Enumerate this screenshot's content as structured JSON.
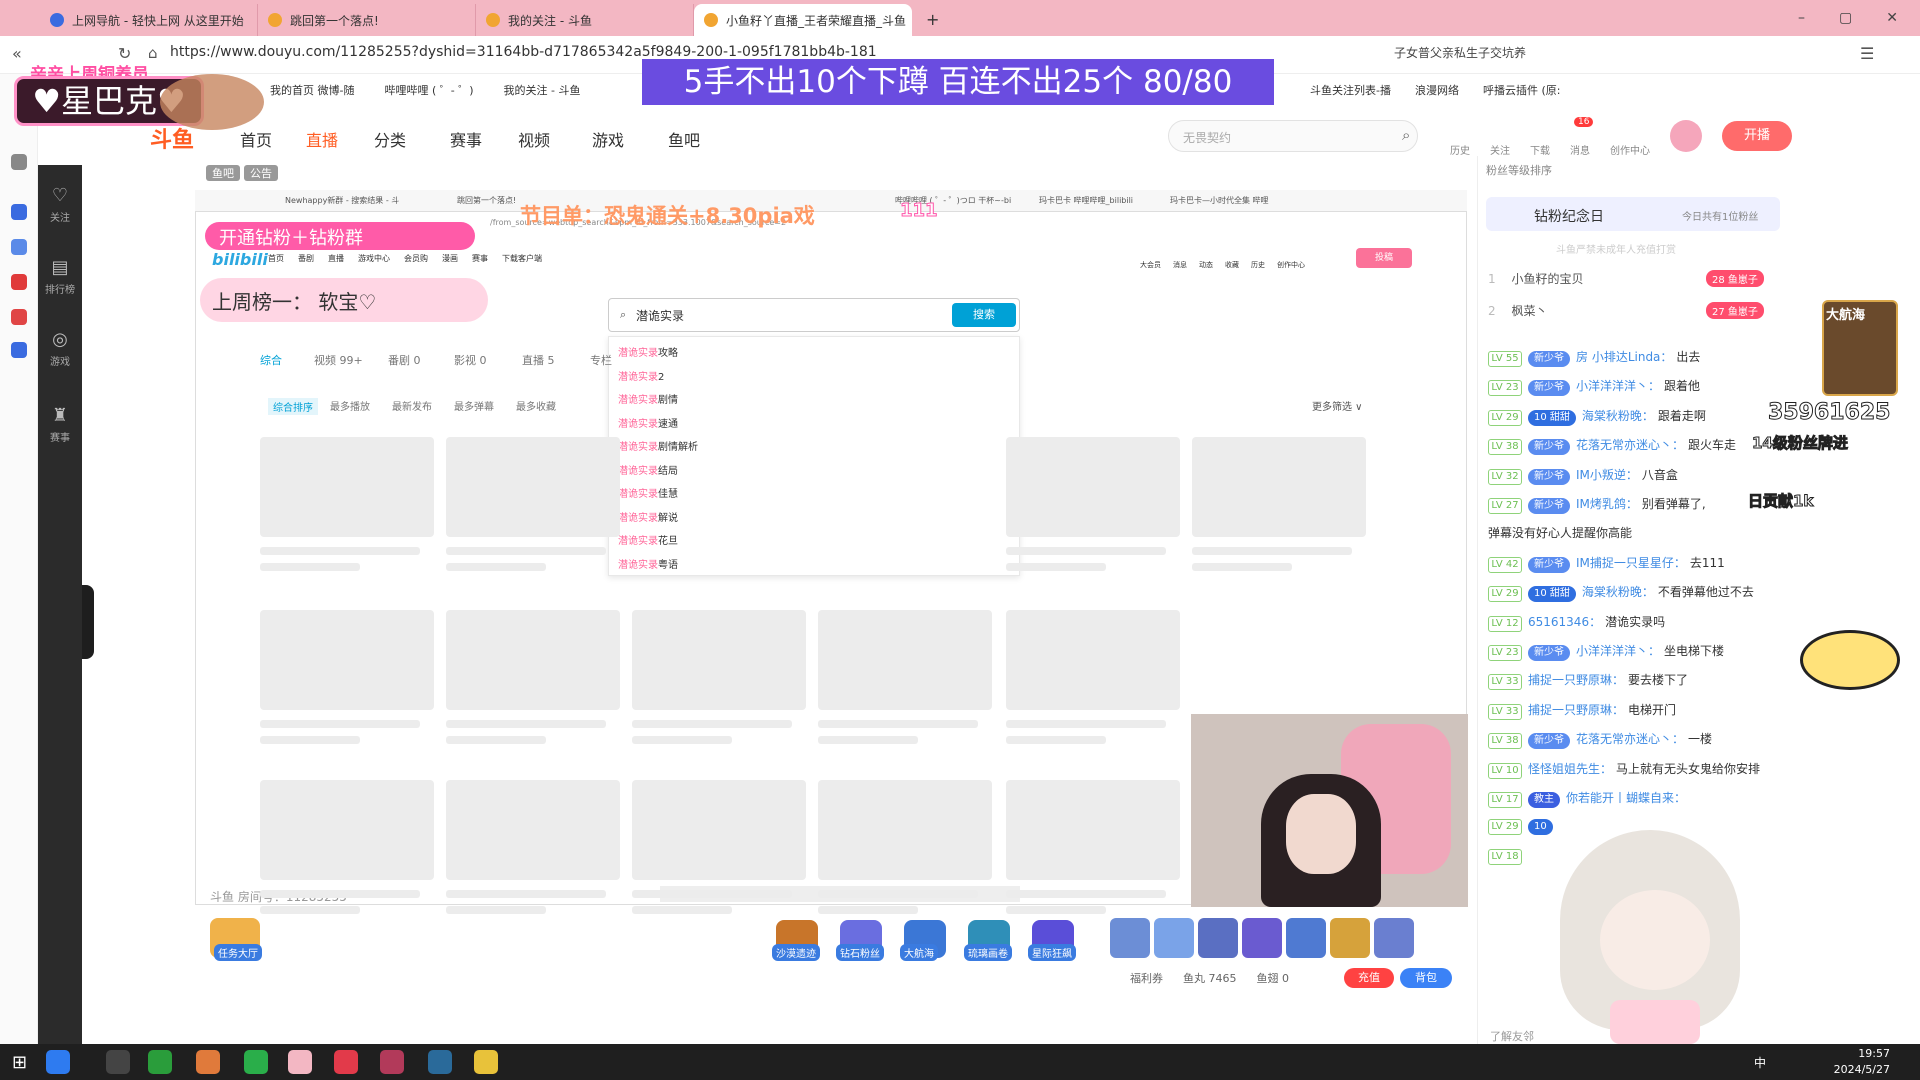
{
  "browser": {
    "tabs": [
      {
        "title": "上网导航 - 轻快上网 从这里开始"
      },
      {
        "title": "跳回第一个落点!"
      },
      {
        "title": "我的关注 - 斗鱼"
      },
      {
        "title": "小鱼籽丫直播_王者荣耀直播_斗鱼"
      }
    ],
    "url": "https://www.douyu.com/11285255?dyshid=31164bb-d717865342a5f9849-200-1-095f1781bb4b-181",
    "bookmarks": [
      "我的首页 微博-随",
      "哔哩哔哩 ( ゜- ゜)",
      "我的关注 - 斗鱼",
      "斗鱼关注列表-播",
      "浪漫网络",
      "呼播云插件 (原:",
      "子女普父亲私生子交坑养"
    ],
    "window_controls": [
      "–",
      "▢",
      "✕"
    ]
  },
  "douyu_header": {
    "logo": "斗鱼",
    "nav": [
      "首页",
      "直播",
      "分类",
      "赛事",
      "视频",
      "游戏",
      "鱼吧"
    ],
    "search_placeholder": "无畏契约",
    "icons": [
      "历史",
      "关注",
      "下载",
      "消息",
      "创作中心"
    ],
    "message_count": "16",
    "kaibo": "开播"
  },
  "douyu_sidebar": [
    "关注",
    "排行榜",
    "游戏",
    "赛事"
  ],
  "stream_overlay": {
    "title": "5手不出10个下蹲  百连不出25个  80/80",
    "xingbake": "♥星巴克♥",
    "xingbake_top": "亲亲上周铜养员",
    "program": "节目单：恐鬼通关+8.30pia戏",
    "program_num": "111",
    "kaitong": "开通钻粉＋钻粉群",
    "last_week": "上周榜一：  软宝♡",
    "fans_level_text": "粉丝等级排序",
    "dim_room": "斗鱼 房间号：11285255",
    "top_tabs": [
      "鱼吧",
      "公告"
    ]
  },
  "inner_browser": {
    "tabs": [
      "Newhappy新群 - 搜索结果 - 斗",
      "跳回第一个落点!",
      "哔哩哔哩 ( ゜- ゜)つロ 干杯~-bi",
      "玛卡巴卡 哔哩哔哩_bilibili",
      "玛卡巴卡—小时代全集 哔哩"
    ],
    "url": "/from_source=webtop_search&spm_id_from=333.1007&search_source=2",
    "bili_nav": [
      "首页",
      "番剧",
      "直播",
      "游戏中心",
      "会员购",
      "漫画",
      "赛事",
      "下载客户端"
    ],
    "search_value": "潜诡实录",
    "search_button": "搜索",
    "suggestions": [
      {
        "hl": "潜诡实录",
        "rest": "攻略"
      },
      {
        "hl": "潜诡实录",
        "rest": "2"
      },
      {
        "hl": "潜诡实录",
        "rest": "剧情"
      },
      {
        "hl": "潜诡实录",
        "rest": "速通"
      },
      {
        "hl": "潜诡实录",
        "rest": "剧情解析"
      },
      {
        "hl": "潜诡实录",
        "rest": "结局"
      },
      {
        "hl": "潜诡实录",
        "rest": "佳慧"
      },
      {
        "hl": "潜诡实录",
        "rest": "解说"
      },
      {
        "hl": "潜诡实录",
        "rest": "花旦"
      },
      {
        "hl": "潜诡实录",
        "rest": "粤语"
      }
    ],
    "result_tabs": [
      "综合",
      "视频 99+",
      "番剧 0",
      "影视 0",
      "直播 5",
      "专栏"
    ],
    "sort_options": [
      "综合排序",
      "最多播放",
      "最新发布",
      "最多弹幕",
      "最多收藏"
    ],
    "more_filter": "更多筛选 ∨",
    "header_icons": [
      "大会员",
      "消息",
      "动态",
      "收藏",
      "历史",
      "创作中心"
    ],
    "upload": "投稿"
  },
  "gift_bar": {
    "task": "任务大厅",
    "items": [
      "沙漠遗迹",
      "钻石粉丝",
      "大航海",
      "琉璃画卷",
      "星际狂飙"
    ],
    "fuli": "福利券",
    "yuwan": "鱼丸 7465",
    "yuchi": "鱼翅 0",
    "chongzhi": "充值",
    "beibao": "背包"
  },
  "chat": {
    "fans_title": "钻粉纪念日",
    "fans_sub": "今日共有1位粉丝",
    "rank_note": "斗鱼严禁未成年人充值打赏",
    "ranking": [
      {
        "rank": "1",
        "name": "小鱼籽的宝贝",
        "badge": "28 鱼崽子"
      },
      {
        "rank": "2",
        "name": "枫菜丶",
        "badge": "27 鱼崽子"
      }
    ],
    "messages": [
      {
        "lv": "LV 55",
        "badge": "新少爷",
        "user": "房 小排达Linda：",
        "text": "出去"
      },
      {
        "lv": "LV 23",
        "badge": "新少爷",
        "user": "小洋洋洋洋丶：",
        "text": "跟着他"
      },
      {
        "lv": "LV 29",
        "badge": "10 甜甜",
        "user": "海棠秋粉晚：",
        "text": "跟着走啊"
      },
      {
        "lv": "LV 38",
        "badge": "新少爷",
        "user": "花落无常亦迷心丶：",
        "text": "跟火车走"
      },
      {
        "lv": "LV 32",
        "badge": "新少爷",
        "user": "IM小叛逆：",
        "text": "八音盒"
      },
      {
        "lv": "LV 27",
        "badge": "新少爷",
        "user": "IM烤乳鸽：",
        "text": "别看弹幕了,"
      },
      {
        "lv": "",
        "badge": "",
        "user": "",
        "text": "弹幕没有好心人提醒你高能"
      },
      {
        "lv": "LV 42",
        "badge": "新少爷",
        "user": "IM捕捉一只星星仔：",
        "text": "去111"
      },
      {
        "lv": "LV 29",
        "badge": "10 甜甜",
        "user": "海棠秋粉晚：",
        "text": "不看弹幕他过不去"
      },
      {
        "lv": "LV 12",
        "badge": "",
        "user": "65161346：",
        "text": "潜诡实录吗"
      },
      {
        "lv": "LV 23",
        "badge": "新少爷",
        "user": "小洋洋洋洋丶：",
        "text": "坐电梯下楼"
      },
      {
        "lv": "LV 33",
        "badge": "",
        "user": "捕捉一只野原琳：",
        "text": "要去楼下了"
      },
      {
        "lv": "LV 33",
        "badge": "",
        "user": "捕捉一只野原琳：",
        "text": "电梯开门"
      },
      {
        "lv": "LV 38",
        "badge": "新少爷",
        "user": "花落无常亦迷心丶：",
        "text": "一楼"
      },
      {
        "lv": "LV 10",
        "badge": "",
        "user": "怪怪姐姐先生：",
        "text": "马上就有无头女鬼给你安排"
      },
      {
        "lv": "LV 17",
        "badge": "教主",
        "user": "你若能开丨蝴蝶自来：",
        "text": ""
      },
      {
        "lv": "LV 29",
        "badge": "10",
        "user": "",
        "text": ""
      },
      {
        "lv": "LV 18",
        "badge": "",
        "user": "",
        "text": ""
      }
    ],
    "gift_num": "35961625",
    "sub14": "14级粉丝牌进",
    "ribon": "日贡献1k",
    "right_deco": "大航海",
    "know_friend": "了解友邻"
  },
  "taskbar": {
    "time": "19:57",
    "date": "2024/5/27",
    "ime": "中"
  }
}
